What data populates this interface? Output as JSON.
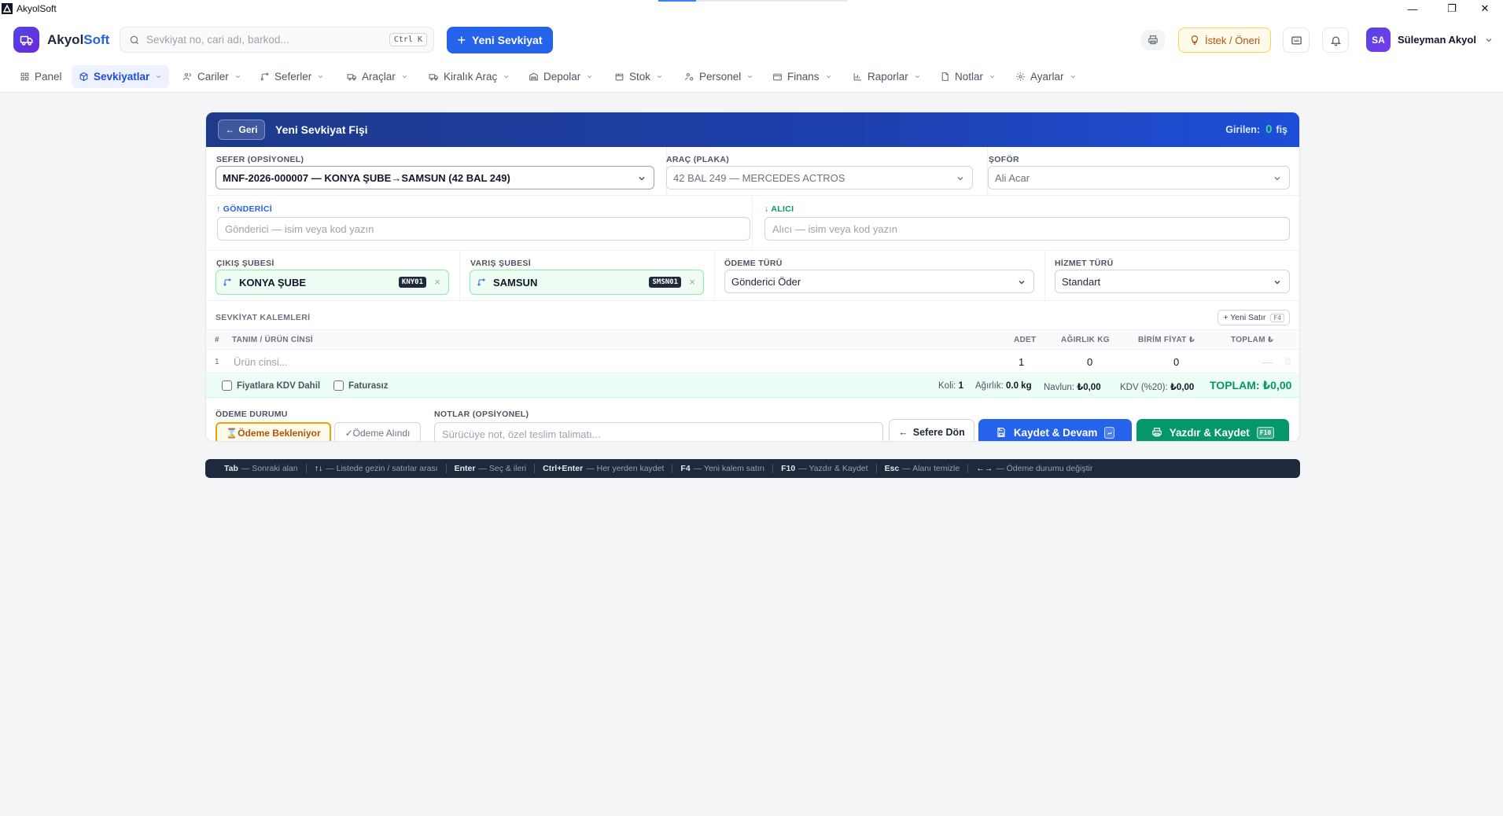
{
  "window": {
    "title": "AkyolSoft",
    "minimize": "—",
    "restore": "❐",
    "close": "✕"
  },
  "header": {
    "brand_prefix": "Akyol",
    "brand_suffix": "Soft",
    "search_placeholder": "Sevkiyat no, cari adı, barkod...",
    "search_shortcut": "Ctrl K",
    "new_shipment_label": "Yeni Sevkiyat",
    "suggestion_label": "İstek / Öneri",
    "user_initials": "SA",
    "user_name": "Süleyman Akyol"
  },
  "nav": {
    "items": [
      {
        "label": "Panel",
        "icon": "grid-icon",
        "dropdown": false
      },
      {
        "label": "Sevkiyatlar",
        "icon": "box-icon",
        "dropdown": true,
        "active": true
      },
      {
        "label": "Cariler",
        "icon": "users-icon",
        "dropdown": true
      },
      {
        "label": "Seferler",
        "icon": "route-icon",
        "dropdown": true
      },
      {
        "label": "Araçlar",
        "icon": "truck-icon",
        "dropdown": true
      },
      {
        "label": "Kiralık Araç",
        "icon": "truck-key-icon",
        "dropdown": true
      },
      {
        "label": "Depolar",
        "icon": "warehouse-icon",
        "dropdown": true
      },
      {
        "label": "Stok",
        "icon": "package-icon",
        "dropdown": true
      },
      {
        "label": "Personel",
        "icon": "user-gear-icon",
        "dropdown": true
      },
      {
        "label": "Finans",
        "icon": "wallet-icon",
        "dropdown": true
      },
      {
        "label": "Raporlar",
        "icon": "bar-chart-icon",
        "dropdown": true
      },
      {
        "label": "Notlar",
        "icon": "note-icon",
        "dropdown": true
      },
      {
        "label": "Ayarlar",
        "icon": "gear-icon",
        "dropdown": true
      }
    ]
  },
  "form": {
    "back_label": "Geri",
    "title": "Yeni Sevkiyat Fişi",
    "entered_label": "Girilen:",
    "entered_count": "0",
    "entered_unit": "fiş",
    "trip_label": "SEFER (OPSİYONEL)",
    "trip_value": "MNF-2026-000007 — KONYA ŞUBE→SAMSUN (42 BAL 249)",
    "vehicle_label": "ARAÇ (PLAKA)",
    "vehicle_value": "42 BAL 249 — MERCEDES ACTROS",
    "driver_label": "ŞOFÖR",
    "driver_value": "Ali Acar",
    "sender_label": "GÖNDERİCİ",
    "sender_placeholder": "Gönderici — isim veya kod yazın",
    "receiver_label": "ALICI",
    "receiver_placeholder": "Alıcı — isim veya kod yazın",
    "origin_label": "ÇIKIŞ ŞUBESİ",
    "origin_value": "KONYA ŞUBE",
    "origin_code": "KNY01",
    "dest_label": "VARIŞ ŞUBESİ",
    "dest_value": "SAMSUN",
    "dest_code": "SMSN01",
    "payment_type_label": "ÖDEME TÜRÜ",
    "payment_type_value": "Gönderici Öder",
    "service_type_label": "HİZMET TÜRÜ",
    "service_type_value": "Standart"
  },
  "items": {
    "section_label": "SEVKİYAT KALEMLERİ",
    "new_row_label": "+ Yeni Satır",
    "new_row_key": "F4",
    "columns": {
      "num": "#",
      "desc": "TANIM / ÜRÜN CİNSİ",
      "qty": "ADET",
      "weight": "AĞIRLIK KG",
      "unit_price": "BİRİM FİYAT ₺",
      "total": "TOPLAM ₺"
    },
    "rows": [
      {
        "num": "1",
        "desc_placeholder": "Ürün cinsi...",
        "qty": "1",
        "weight": "0",
        "unit_price": "0",
        "total": "—"
      }
    ]
  },
  "summary": {
    "vat_included": "Fiyatlara KDV Dahil",
    "no_invoice": "Faturasız",
    "parcel_label": "Koli:",
    "parcel_value": "1",
    "weight_label": "Ağırlık:",
    "weight_value": "0.0 kg",
    "freight_label": "Navlun:",
    "freight_value": "₺0,00",
    "vat_label": "KDV (%20):",
    "vat_value": "₺0,00",
    "total_label": "TOPLAM:",
    "total_value": "₺0,00"
  },
  "footer": {
    "payment_status_label": "ÖDEME DURUMU",
    "payment_pending": "⌛Ödeme Bekleniyor",
    "payment_received": "✓Ödeme Alındı",
    "notes_label": "NOTLAR (OPSİYONEL)",
    "notes_placeholder": "Sürücüye not, özel teslim talimatı...",
    "back_to_trip": "Sefere Dön",
    "save_continue": "Kaydet & Devam",
    "save_continue_key": "↵",
    "print_save": "Yazdır & Kaydet",
    "print_save_key": "F10"
  },
  "hints": [
    {
      "key": "Tab",
      "text": "— Sonraki alan"
    },
    {
      "key": "↑↓",
      "text": "— Listede gezin / satırlar arası"
    },
    {
      "key": "Enter",
      "text": "— Seç & ileri"
    },
    {
      "key": "Ctrl+Enter",
      "text": "— Her yerden kaydet"
    },
    {
      "key": "F4",
      "text": "— Yeni kalem satırı"
    },
    {
      "key": "F10",
      "text": "— Yazdır & Kaydet"
    },
    {
      "key": "Esc",
      "text": "— Alanı temizle"
    },
    {
      "key": "←→",
      "text": "— Ödeme durumu değiştir"
    }
  ],
  "colors": {
    "primary": "#2563eb",
    "success": "#059669",
    "warning": "#f59e0b",
    "header_dark": "#1e3a8a"
  }
}
